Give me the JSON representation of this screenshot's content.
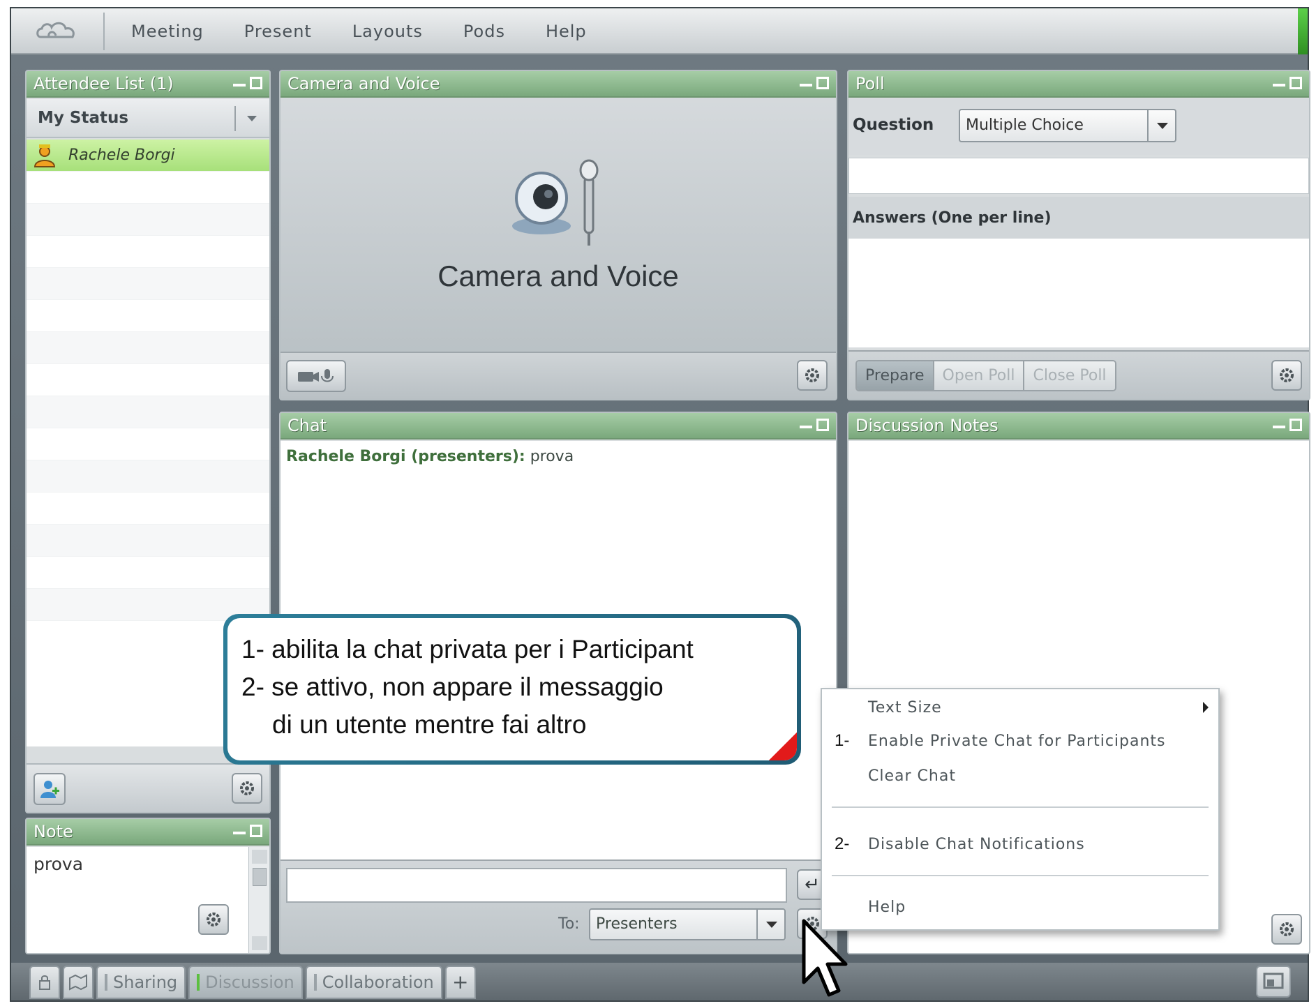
{
  "menubar": {
    "items": [
      "Meeting",
      "Present",
      "Layouts",
      "Pods",
      "Help"
    ]
  },
  "attendee_pod": {
    "title": "Attendee List (1)",
    "my_status_label": "My Status",
    "attendees": [
      {
        "name": "Rachele Borgi",
        "role": "host",
        "selected": true
      }
    ]
  },
  "camera_pod": {
    "title": "Camera and Voice",
    "center_label": "Camera and Voice"
  },
  "poll_pod": {
    "title": "Poll",
    "question_label": "Question",
    "question_type": "Multiple Choice",
    "answers_label": "Answers (One per line)",
    "buttons": [
      {
        "label": "Prepare",
        "active": true
      },
      {
        "label": "Open Poll",
        "active": false
      },
      {
        "label": "Close Poll",
        "active": false
      }
    ]
  },
  "chat_pod": {
    "title": "Chat",
    "messages": [
      {
        "sender": "Rachele Borgi (presenters):",
        "text": " prova"
      }
    ],
    "to_label": "To:",
    "to_value": "Presenters"
  },
  "discussion_pod": {
    "title": "Discussion Notes"
  },
  "note_pod": {
    "title": "Note",
    "text": "prova"
  },
  "callout": {
    "line1": "1- abilita la chat privata per i Participant",
    "line2": "2- se attivo, non appare il messaggio",
    "line3": "di un utente mentre fai altro"
  },
  "context_menu": {
    "text_size": "Text Size",
    "num1": "1-",
    "enable_private": "Enable Private Chat for Participants",
    "clear_chat": "Clear Chat",
    "num2": "2-",
    "disable_notifications": "Disable Chat Notifications",
    "help": "Help"
  },
  "tabbar": {
    "tabs": [
      {
        "label": "Sharing",
        "active": false
      },
      {
        "label": "Discussion",
        "active": true
      },
      {
        "label": "Collaboration",
        "active": false
      }
    ],
    "add_label": "+"
  },
  "colors": {
    "pod_title_green": "#7aa87c",
    "selected_attendee": "#a7e07a",
    "callout_border": "#1f5b74",
    "callout_corner": "#e21a1a"
  }
}
